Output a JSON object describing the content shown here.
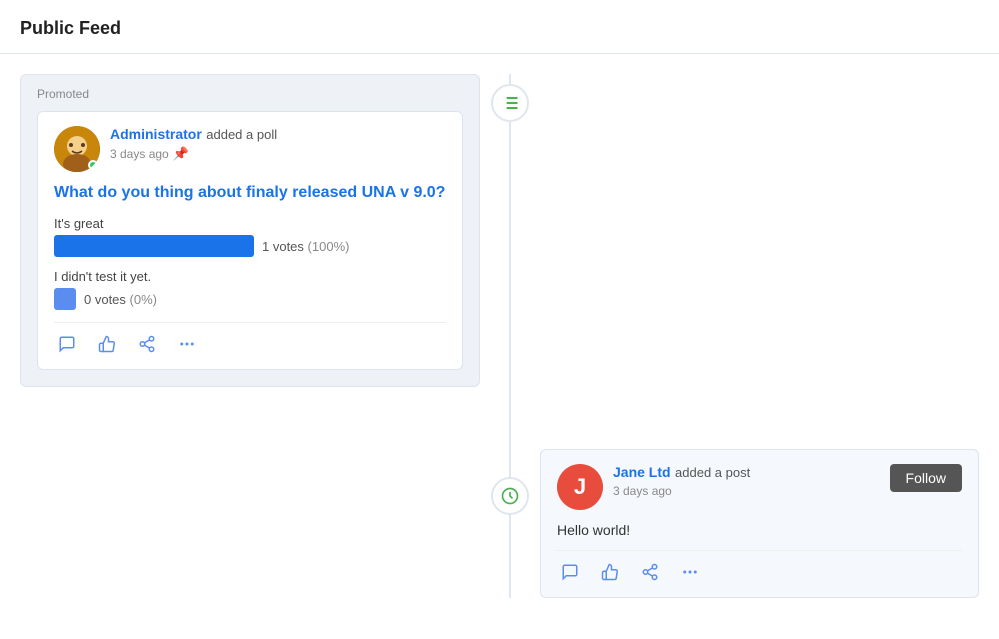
{
  "page": {
    "title": "Public Feed"
  },
  "promoted_card": {
    "label": "Promoted",
    "author": "Administrator",
    "action": "added a poll",
    "time": "3 days ago",
    "poll_title": "What do you thing about finaly released UNA v 9.0?",
    "options": [
      {
        "label": "It's great",
        "votes_count": "1 votes",
        "pct": "(100%)",
        "bar_type": "full"
      },
      {
        "label": "I didn't test it yet.",
        "votes_count": "0 votes",
        "pct": "(0%)",
        "bar_type": "empty"
      }
    ]
  },
  "jane_post": {
    "author": "Jane Ltd",
    "action": "added a post",
    "time": "3 days ago",
    "content": "Hello world!",
    "follow_label": "Follow",
    "avatar_letter": "J"
  },
  "actions": {
    "comment": "💬",
    "like": "👍",
    "share": "↗",
    "more": "•••"
  }
}
